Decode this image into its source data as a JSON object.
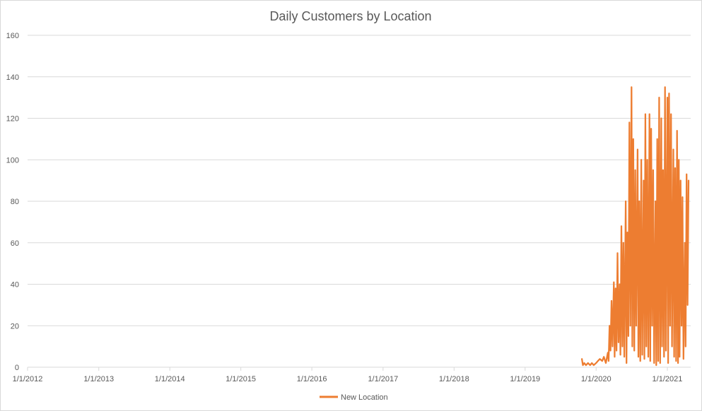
{
  "chart_data": {
    "type": "line",
    "title": "Daily Customers by Location",
    "xlabel": "",
    "ylabel": "",
    "x_tick_labels": [
      "1/1/2012",
      "1/1/2013",
      "1/1/2014",
      "1/1/2015",
      "1/1/2016",
      "1/1/2017",
      "1/1/2018",
      "1/1/2019",
      "1/1/2020",
      "1/1/2021"
    ],
    "y_tick_labels": [
      "0",
      "20",
      "40",
      "60",
      "80",
      "100",
      "120",
      "140",
      "160"
    ],
    "xlim": [
      "2012-01-01",
      "2021-05-01"
    ],
    "ylim": [
      0,
      160
    ],
    "grid": "horizontal",
    "legend_position": "bottom",
    "series": [
      {
        "name": "New Location",
        "color": "#ED7D31",
        "x": [
          "2019-10-20",
          "2019-10-25",
          "2019-11-01",
          "2019-11-10",
          "2019-11-20",
          "2019-12-01",
          "2019-12-10",
          "2019-12-20",
          "2020-01-01",
          "2020-01-10",
          "2020-01-20",
          "2020-02-01",
          "2020-02-10",
          "2020-02-20",
          "2020-03-01",
          "2020-03-05",
          "2020-03-10",
          "2020-03-15",
          "2020-03-20",
          "2020-03-25",
          "2020-04-01",
          "2020-04-05",
          "2020-04-10",
          "2020-04-15",
          "2020-04-20",
          "2020-04-25",
          "2020-05-01",
          "2020-05-05",
          "2020-05-10",
          "2020-05-15",
          "2020-05-20",
          "2020-05-25",
          "2020-06-01",
          "2020-06-05",
          "2020-06-10",
          "2020-06-15",
          "2020-06-20",
          "2020-06-25",
          "2020-07-01",
          "2020-07-05",
          "2020-07-10",
          "2020-07-15",
          "2020-07-20",
          "2020-07-25",
          "2020-08-01",
          "2020-08-05",
          "2020-08-10",
          "2020-08-15",
          "2020-08-20",
          "2020-08-25",
          "2020-09-01",
          "2020-09-05",
          "2020-09-10",
          "2020-09-15",
          "2020-09-20",
          "2020-09-25",
          "2020-10-01",
          "2020-10-05",
          "2020-10-10",
          "2020-10-15",
          "2020-10-20",
          "2020-10-25",
          "2020-11-01",
          "2020-11-05",
          "2020-11-10",
          "2020-11-15",
          "2020-11-20",
          "2020-11-25",
          "2020-12-01",
          "2020-12-05",
          "2020-12-10",
          "2020-12-15",
          "2020-12-20",
          "2020-12-25",
          "2021-01-01",
          "2021-01-05",
          "2021-01-10",
          "2021-01-15",
          "2021-01-20",
          "2021-01-25",
          "2021-02-01",
          "2021-02-05",
          "2021-02-10",
          "2021-02-15",
          "2021-02-20",
          "2021-02-25",
          "2021-03-01",
          "2021-03-05",
          "2021-03-10",
          "2021-03-15",
          "2021-03-20",
          "2021-03-25",
          "2021-04-01",
          "2021-04-05",
          "2021-04-10",
          "2021-04-15",
          "2021-04-20"
        ],
        "values": [
          4,
          1,
          2,
          1,
          2,
          1,
          2,
          1,
          2,
          3,
          4,
          3,
          5,
          2,
          7,
          3,
          20,
          8,
          32,
          10,
          41,
          5,
          38,
          8,
          55,
          12,
          40,
          6,
          68,
          10,
          60,
          5,
          80,
          2,
          65,
          15,
          118,
          20,
          135,
          10,
          110,
          8,
          95,
          20,
          105,
          5,
          80,
          3,
          100,
          6,
          90,
          4,
          122,
          10,
          100,
          5,
          122,
          3,
          115,
          20,
          95,
          2,
          80,
          1,
          110,
          3,
          130,
          2,
          120,
          10,
          95,
          5,
          135,
          8,
          130,
          2,
          132,
          20,
          122,
          10,
          105,
          5,
          96,
          3,
          114,
          2,
          100,
          5,
          90,
          20,
          82,
          4,
          60,
          10,
          93,
          30,
          90
        ]
      }
    ]
  }
}
